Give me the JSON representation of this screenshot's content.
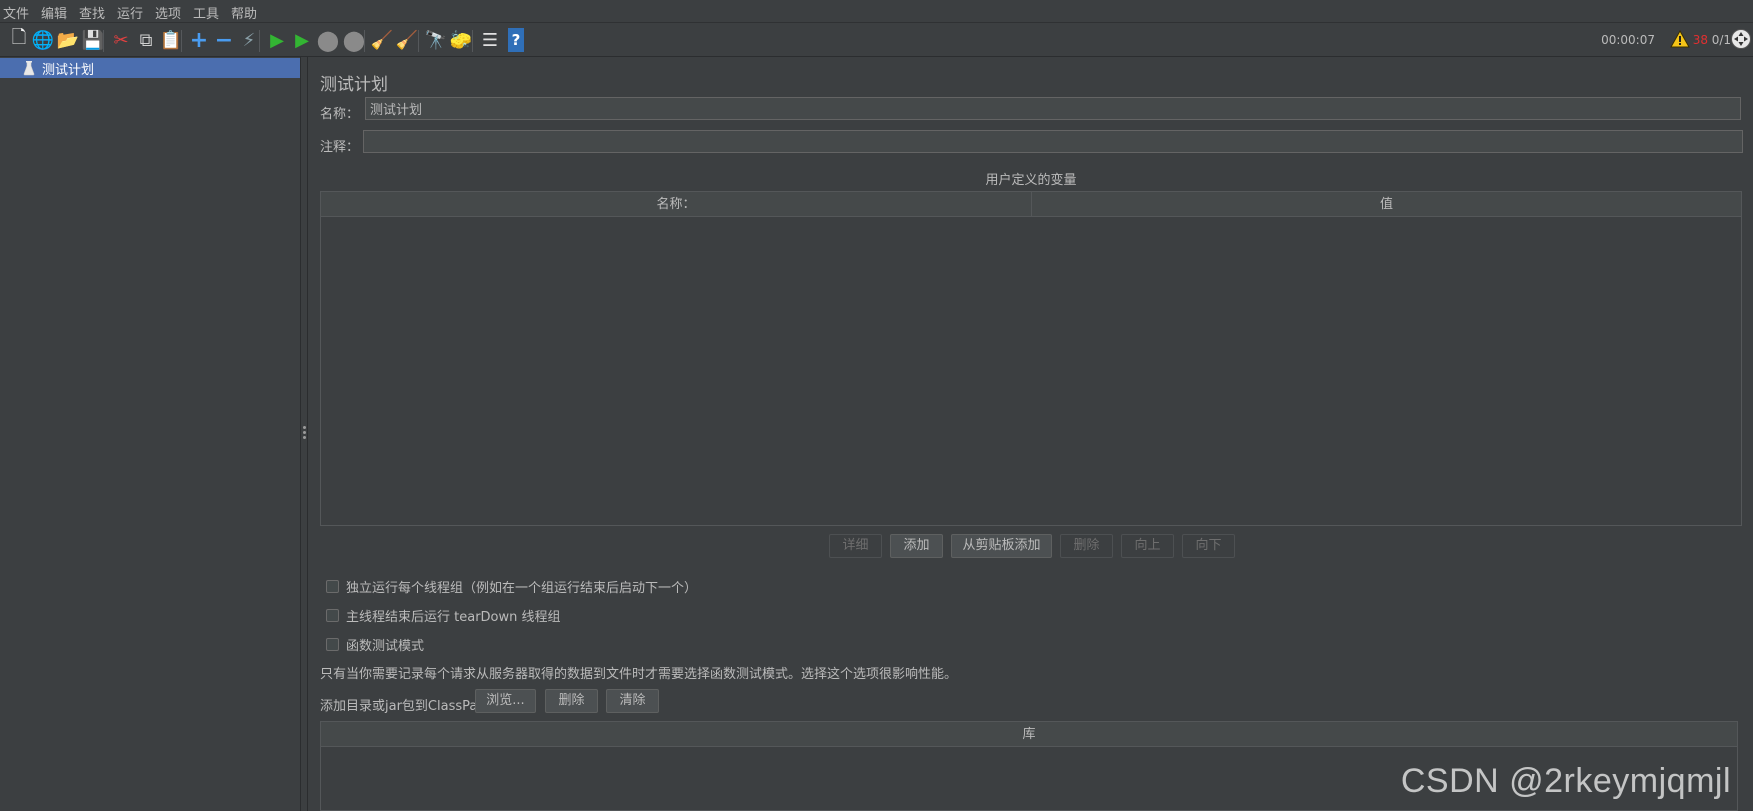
{
  "menu": [
    "文件",
    "编辑",
    "查找",
    "运行",
    "选项",
    "工具",
    "帮助"
  ],
  "toolbar": {
    "icons": [
      {
        "name": "new-icon",
        "glyph": "🗋",
        "color": "#f0f0f0"
      },
      {
        "name": "templates-icon",
        "glyph": "🌐",
        "color": "#4caf50"
      },
      {
        "name": "open-icon",
        "glyph": "📂",
        "color": "#e8b84a"
      },
      {
        "name": "save-icon",
        "glyph": "💾",
        "color": "#c8c8c8"
      },
      {
        "name": "cut-icon",
        "glyph": "✂",
        "color": "#e04040"
      },
      {
        "name": "copy-icon",
        "glyph": "⧉",
        "color": "#d0d0d0"
      },
      {
        "name": "paste-icon",
        "glyph": "📋",
        "color": "#e8b84a"
      },
      {
        "name": "expand-icon",
        "glyph": "+",
        "color": "#4a9cf0"
      },
      {
        "name": "collapse-icon",
        "glyph": "−",
        "color": "#4a9cf0"
      },
      {
        "name": "toggle-icon",
        "glyph": "⚡",
        "color": "#8aa0a8"
      },
      {
        "name": "start-icon",
        "glyph": "▶",
        "color": "#33b533"
      },
      {
        "name": "start-no-pause-icon",
        "glyph": "▶",
        "color": "#33b533"
      },
      {
        "name": "stop-icon",
        "glyph": "⬤",
        "color": "#8a8a8a"
      },
      {
        "name": "shutdown-icon",
        "glyph": "⬤",
        "color": "#8a8a8a"
      },
      {
        "name": "clear-icon",
        "glyph": "🧹",
        "color": "#c8a878"
      },
      {
        "name": "clear-all-icon",
        "glyph": "🧹",
        "color": "#c8a878"
      },
      {
        "name": "search-icon",
        "glyph": "🔭",
        "color": "#d0d0d0"
      },
      {
        "name": "reset-search-icon",
        "glyph": "🧽",
        "color": "#f0d040"
      },
      {
        "name": "function-helper-icon",
        "glyph": "☰",
        "color": "#e0e0e0"
      },
      {
        "name": "help-icon",
        "glyph": "?",
        "color": "#4a9cf0"
      }
    ],
    "timer": "00:00:07",
    "error_count": "38",
    "threads": "0/1"
  },
  "tree": {
    "selected_label": "测试计划"
  },
  "test_plan": {
    "title": "测试计划",
    "name_label": "名称：",
    "name_value": "测试计划",
    "comment_label": "注释：",
    "comment_value": "",
    "vars_caption": "用户定义的变量",
    "vars_columns": [
      "名称：",
      "值"
    ],
    "vars_rows": [],
    "buttons": [
      {
        "label": "详细",
        "enabled": false
      },
      {
        "label": "添加",
        "enabled": true
      },
      {
        "label": "从剪贴板添加",
        "enabled": true
      },
      {
        "label": "删除",
        "enabled": false
      },
      {
        "label": "向上",
        "enabled": false
      },
      {
        "label": "向下",
        "enabled": false
      }
    ],
    "checkboxes": [
      {
        "label": "独立运行每个线程组（例如在一个组运行结束后启动下一个）",
        "checked": false
      },
      {
        "label": "主线程结束后运行 tearDown 线程组",
        "checked": false
      },
      {
        "label": "函数测试模式",
        "checked": false
      }
    ],
    "note": "只有当你需要记录每个请求从服务器取得的数据到文件时才需要选择函数测试模式。选择这个选项很影响性能。",
    "classpath_label": "添加目录或jar包到ClassPath",
    "classpath_buttons": [
      "浏览...",
      "删除",
      "清除"
    ],
    "library_header": "库"
  },
  "watermark": "CSDN @2rkeymjqmjl",
  "colors": {
    "background": "#3c3f41",
    "selection": "#4b6eaf",
    "text": "#bbbbbb",
    "error": "#e03030"
  }
}
